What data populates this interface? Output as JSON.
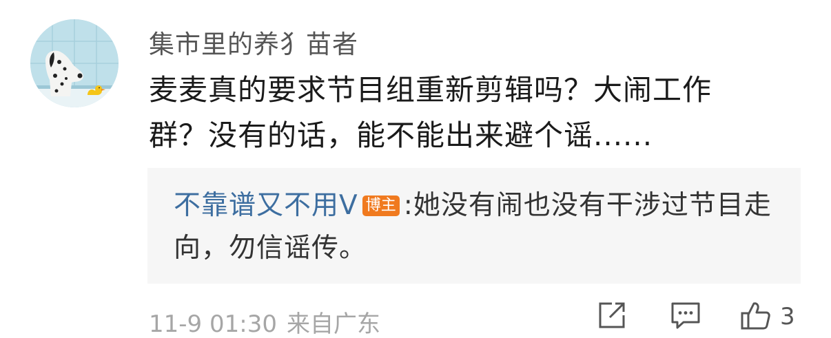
{
  "comment": {
    "username": "集市里的养犭苗者",
    "text": "麦麦真的要求节目组重新剪辑吗？大闹工作群？没有的话，能不能出来避个谣......",
    "reply": {
      "author": "不靠谱又不用V",
      "badge": "博主",
      "separator": ":",
      "text": "她没有闹也没有干涉过节目走向，勿信谣传。"
    },
    "footer": {
      "timestamp": "11-9 01:30",
      "source": "来自广东",
      "like_count": "3"
    }
  },
  "icons": {
    "share": "share-icon",
    "comment": "comment-icon",
    "like": "thumbs-up-icon"
  },
  "colors": {
    "reply_author": "#3d6ea0",
    "badge_bg": "#f07a1f",
    "meta_text": "#a6a6a6"
  }
}
